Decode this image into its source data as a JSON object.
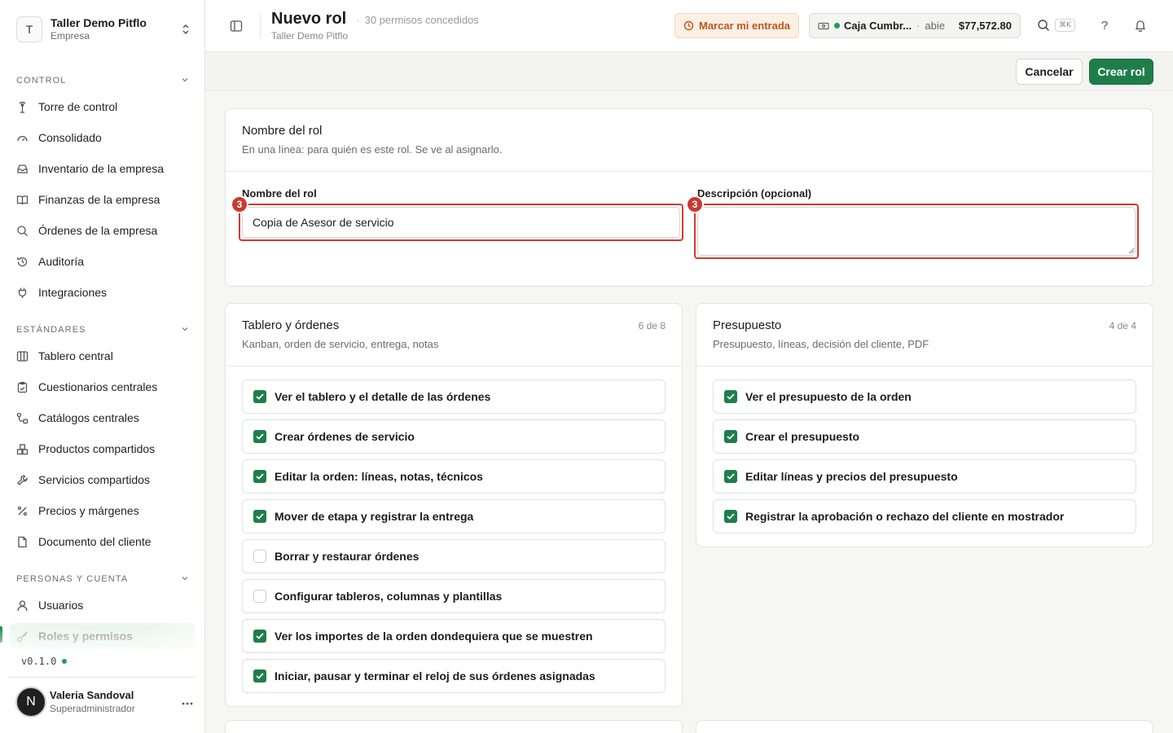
{
  "org": {
    "initial": "T",
    "name": "Taller Demo Pitflo",
    "type": "Empresa"
  },
  "sidebar": {
    "sections": [
      {
        "label": "CONTROL",
        "items": [
          {
            "label": "Torre de control",
            "icon": "tower-icon"
          },
          {
            "label": "Consolidado",
            "icon": "gauge-icon"
          },
          {
            "label": "Inventario de la empresa",
            "icon": "inbox-icon"
          },
          {
            "label": "Finanzas de la empresa",
            "icon": "book-icon"
          },
          {
            "label": "Órdenes de la empresa",
            "icon": "search-icon"
          },
          {
            "label": "Auditoría",
            "icon": "history-icon"
          },
          {
            "label": "Integraciones",
            "icon": "plug-icon"
          }
        ]
      },
      {
        "label": "ESTÁNDARES",
        "items": [
          {
            "label": "Tablero central",
            "icon": "columns-icon"
          },
          {
            "label": "Cuestionarios centrales",
            "icon": "clipboard-icon"
          },
          {
            "label": "Catálogos centrales",
            "icon": "flow-icon"
          },
          {
            "label": "Productos compartidos",
            "icon": "boxes-icon"
          },
          {
            "label": "Servicios compartidos",
            "icon": "wrench-icon"
          },
          {
            "label": "Precios y márgenes",
            "icon": "percent-icon"
          },
          {
            "label": "Documento del cliente",
            "icon": "document-icon"
          }
        ]
      },
      {
        "label": "PERSONAS Y CUENTA",
        "items": [
          {
            "label": "Usuarios",
            "icon": "user-icon"
          },
          {
            "label": "Roles y permisos",
            "icon": "key-icon",
            "active": true
          }
        ]
      }
    ],
    "version": "v0.1.0",
    "user": {
      "initial": "N",
      "name": "Valeria Sandoval",
      "role": "Superadministrador"
    }
  },
  "header": {
    "title": "Nuevo rol",
    "meta": "30 permisos concedidos",
    "subtitle": "Taller Demo Pitflo",
    "clockin_label": "Marcar mi entrada",
    "cash": {
      "name": "Caja Cumbr...",
      "state": "abie",
      "amount": "$77,572.80"
    },
    "shortcut": "⌘K",
    "help": "?"
  },
  "actions": {
    "cancel": "Cancelar",
    "create": "Crear rol"
  },
  "role_card": {
    "title": "Nombre del rol",
    "description": "En una línea: para quién es este rol. Se ve al asignarlo.",
    "name_label": "Nombre del rol",
    "name_value": "Copia de Asesor de servicio",
    "desc_label": "Descripción (opcional)",
    "desc_value": "",
    "badge_name": "3",
    "badge_desc": "3"
  },
  "groups": [
    {
      "title": "Tablero y órdenes",
      "description": "Kanban, orden de servicio, entrega, notas",
      "count": "6 de 8",
      "permissions": [
        {
          "label": "Ver el tablero y el detalle de las órdenes",
          "checked": true
        },
        {
          "label": "Crear órdenes de servicio",
          "checked": true
        },
        {
          "label": "Editar la orden: líneas, notas, técnicos",
          "checked": true
        },
        {
          "label": "Mover de etapa y registrar la entrega",
          "checked": true
        },
        {
          "label": "Borrar y restaurar órdenes",
          "checked": false
        },
        {
          "label": "Configurar tableros, columnas y plantillas",
          "checked": false
        },
        {
          "label": "Ver los importes de la orden dondequiera que se muestren",
          "checked": true
        },
        {
          "label": "Iniciar, pausar y terminar el reloj de sus órdenes asignadas",
          "checked": true
        }
      ]
    },
    {
      "title": "Presupuesto",
      "description": "Presupuesto, líneas, decisión del cliente, PDF",
      "count": "4 de 4",
      "permissions": [
        {
          "label": "Ver el presupuesto de la orden",
          "checked": true
        },
        {
          "label": "Crear el presupuesto",
          "checked": true
        },
        {
          "label": "Editar líneas y precios del presupuesto",
          "checked": true
        },
        {
          "label": "Registrar la aprobación o rechazo del cliente en mostrador",
          "checked": true
        }
      ]
    }
  ],
  "colors": {
    "accent": "#1e7e4a",
    "highlight": "#d23a2f",
    "warning_bg": "#fcefe3",
    "warning_text": "#c2561b"
  }
}
